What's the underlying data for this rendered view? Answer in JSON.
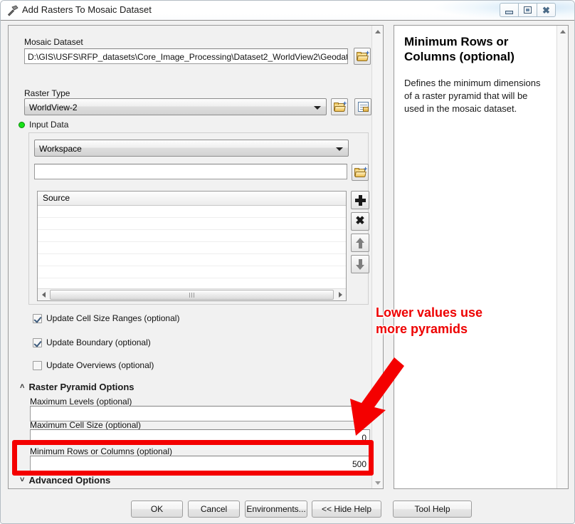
{
  "window": {
    "title": "Add Rasters To Mosaic Dataset",
    "icon": "hammer-tool-icon",
    "controls": {
      "minimize": "minimize",
      "maximize": "maximize",
      "close": "close"
    }
  },
  "form": {
    "mosaic_dataset": {
      "label": "Mosaic Dataset",
      "value": "D:\\GIS\\USFS\\RFP_datasets\\Core_Image_Processing\\Dataset2_WorldView2\\Geodatabase\\W",
      "browse_icon": "open-folder-icon"
    },
    "raster_type": {
      "label": "Raster Type",
      "value": "WorldView-2",
      "browse_icon": "open-folder-icon",
      "properties_icon": "raster-type-properties-icon"
    },
    "input_data": {
      "label": "Input Data",
      "status_icon": "required-green-dot-icon",
      "mode": "Workspace",
      "path_value": "",
      "path_placeholder": "",
      "browse_icon": "open-folder-icon",
      "table": {
        "column_header": "Source",
        "rows": [
          "",
          "",
          "",
          "",
          "",
          "",
          ""
        ]
      },
      "side_buttons": [
        {
          "name": "add-row-button",
          "icon": "plus-icon"
        },
        {
          "name": "remove-row-button",
          "icon": "x-icon"
        },
        {
          "name": "move-up-button",
          "icon": "arrow-up-icon"
        },
        {
          "name": "move-down-button",
          "icon": "arrow-down-icon"
        }
      ]
    },
    "checkboxes": [
      {
        "label": "Update Cell Size Ranges (optional)",
        "checked": true
      },
      {
        "label": "Update Boundary (optional)",
        "checked": true
      },
      {
        "label": "Update Overviews (optional)",
        "checked": false
      }
    ],
    "raster_pyramid_options": {
      "header": "Raster Pyramid Options",
      "expanded": true,
      "chevron": "˄",
      "fields": [
        {
          "label": "Maximum Levels (optional)",
          "value": ""
        },
        {
          "label": "Maximum Cell Size (optional)",
          "value": "0"
        },
        {
          "label": "Minimum Rows or Columns (optional)",
          "value": "500"
        }
      ]
    },
    "advanced_options": {
      "header": "Advanced Options",
      "expanded": false,
      "chevron": "˅"
    }
  },
  "help": {
    "title": "Minimum Rows or Columns (optional)",
    "body": "Defines the minimum dimensions of a raster pyramid that will be used in the mosaic dataset."
  },
  "footer": {
    "buttons": [
      {
        "label": "OK",
        "name": "ok-button"
      },
      {
        "label": "Cancel",
        "name": "cancel-button"
      },
      {
        "label": "Environments...",
        "name": "environments-button"
      },
      {
        "label": "<< Hide Help",
        "name": "hide-help-button"
      },
      {
        "label": "Tool Help",
        "name": "tool-help-button"
      }
    ]
  },
  "annotation": {
    "text_line1": "Lower values use",
    "text_line2": "more pyramids",
    "color": "#ee0000",
    "highlight_color": "#f40000"
  }
}
